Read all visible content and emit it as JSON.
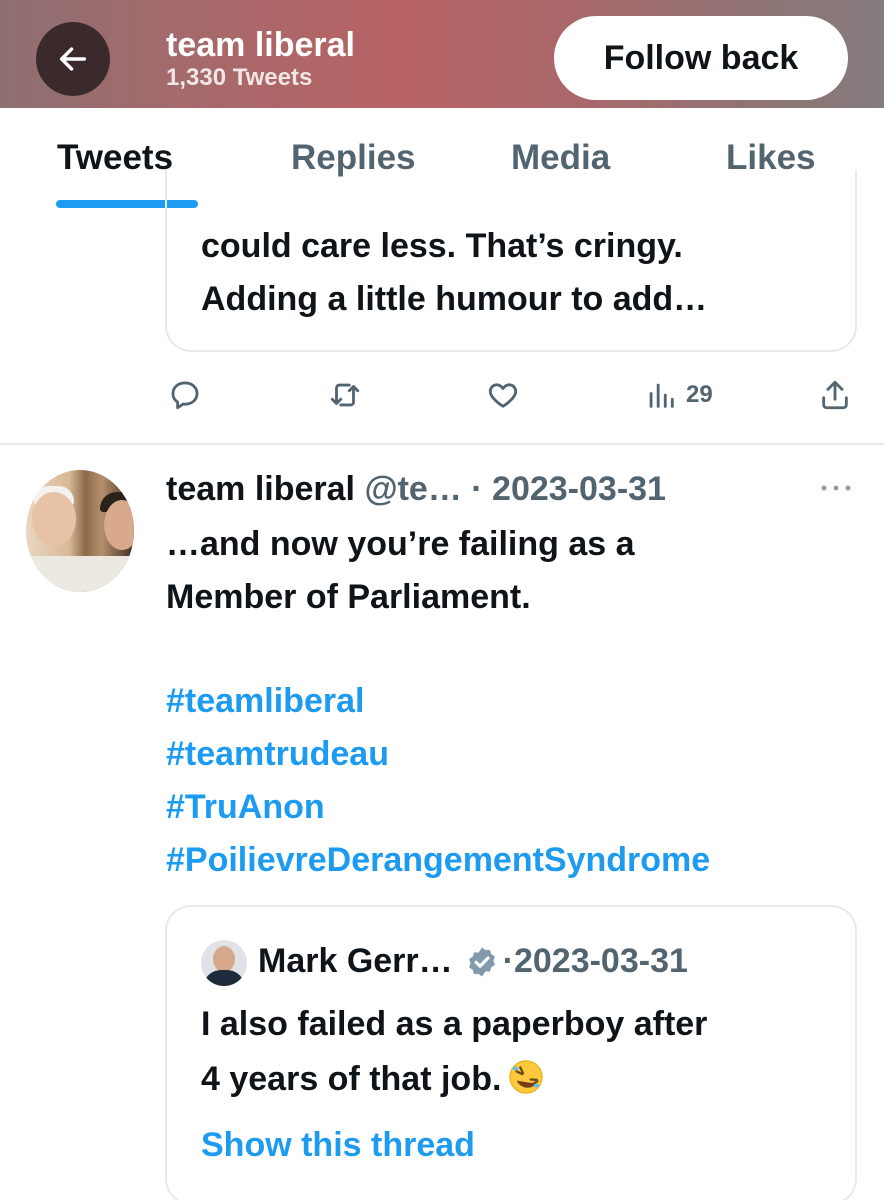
{
  "header": {
    "title": "team liberal",
    "subtitle": "1,330 Tweets",
    "follow_label": "Follow back",
    "back_icon": "arrow-left-icon"
  },
  "tabs": [
    {
      "label": "Tweets",
      "active": true
    },
    {
      "label": "Replies",
      "active": false
    },
    {
      "label": "Media",
      "active": false
    },
    {
      "label": "Likes",
      "active": false
    }
  ],
  "tweet1": {
    "quote_lines": [
      "could care less. That’s cringy.",
      "Adding a little humour to add…"
    ],
    "views": "29",
    "actions": [
      "reply-icon",
      "retweet-icon",
      "like-icon",
      "views-icon",
      "share-icon"
    ]
  },
  "tweet2": {
    "author": "team liberal",
    "handle": "@te…",
    "sep": " · ",
    "date": "2023-03-31",
    "text_lines": [
      "…and now you’re failing as a",
      "Member of Parliament."
    ],
    "hashtags": [
      "#teamliberal",
      "#teamtrudeau",
      "#TruAnon",
      "#PoilievreDerangementSyndrome"
    ],
    "quote": {
      "author": "Mark Gerr…",
      "sep": "·",
      "date": "2023-03-31",
      "text_lines": [
        "I also failed as a paperboy after",
        "4 years of that job."
      ],
      "show_thread": "Show this thread"
    }
  },
  "colors": {
    "accent": "#1d9bf0",
    "text": "#0f1419",
    "muted": "#536471",
    "border": "#e7eaed"
  }
}
